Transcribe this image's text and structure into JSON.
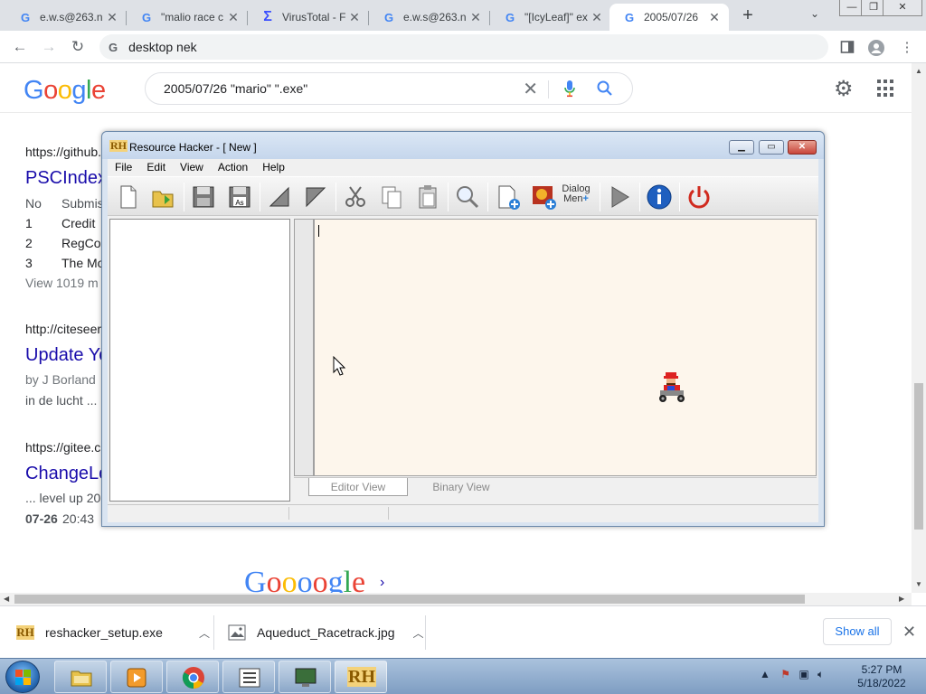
{
  "browser": {
    "tabs": [
      {
        "title": "e.w.s@263.n"
      },
      {
        "title": "\"malio race c"
      },
      {
        "title": "VirusTotal - F"
      },
      {
        "title": "e.w.s@263.n"
      },
      {
        "title": "\"[IcyLeaf]\" ex"
      },
      {
        "title": "2005/07/26"
      }
    ],
    "new_tab": "+",
    "tab_search": "⌄",
    "window_controls": {
      "minimize": "—",
      "restore": "❐",
      "close": "✕"
    },
    "address": "desktop nek",
    "address_icon": "G"
  },
  "google": {
    "logo": "Google",
    "query": "2005/07/26 \"mario\" \".exe\"",
    "results": {
      "r1_cite": "https://github.",
      "r1_title": "PSCIndex",
      "r1_hdr_no": "No",
      "r1_hdr_sub": "Submis",
      "r1_rows": [
        {
          "n": "1",
          "t": "Credit"
        },
        {
          "n": "2",
          "t": "RegCo"
        },
        {
          "n": "3",
          "t": "The Mo"
        }
      ],
      "r1_more": "View 1019 m",
      "r2_cite": "http://citeseer",
      "r2_title": "Update Yo",
      "r2_by": "by J Borland",
      "r2_snip": "in de lucht ...",
      "r3_cite": "https://gitee.c",
      "r3_title": "ChangeLo",
      "r3_snip": "... level up 20",
      "r3_date": "07-26",
      "r3_time": "20:43"
    },
    "pager": "Goooogle",
    "pager_next": "›"
  },
  "resource_hacker": {
    "logo": "RH",
    "title": "Resource Hacker - [ New ]",
    "menu": [
      "File",
      "Edit",
      "View",
      "Action",
      "Help"
    ],
    "dialog_btn": "Dialog",
    "dialog_btn_2": "Men",
    "tabs": {
      "editor": "Editor View",
      "binary": "Binary View"
    }
  },
  "downloads": {
    "items": [
      {
        "name": "reshacker_setup.exe",
        "icon": "RH"
      },
      {
        "name": "Aqueduct_Racetrack.jpg"
      }
    ],
    "show_all": "Show all",
    "close": "✕"
  },
  "taskbar": {
    "time": "5:27 PM",
    "date": "5/18/2022",
    "rh_label": "RH"
  },
  "colors": {
    "google_blue": "#4285f4",
    "google_red": "#ea4335",
    "google_yellow": "#fbbc05",
    "google_green": "#34a853",
    "link_blue": "#1a0dab"
  }
}
